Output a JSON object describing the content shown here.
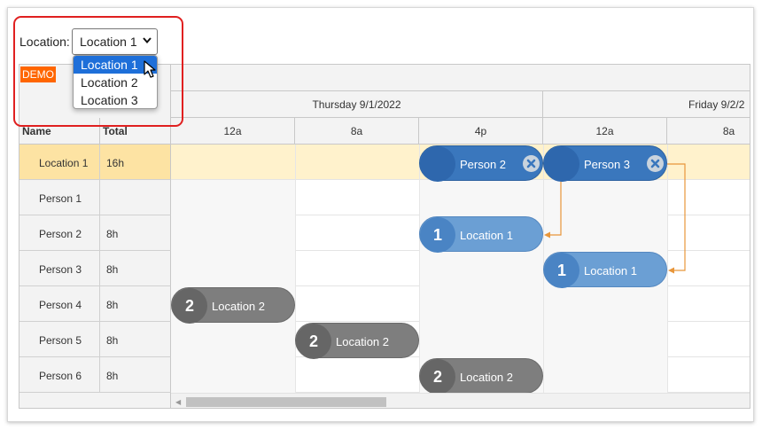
{
  "location_picker": {
    "label": "Location:",
    "selected": "Location 1",
    "options": [
      "Location 1",
      "Location 2",
      "Location 3"
    ]
  },
  "demo_badge": "DEMO",
  "columns": {
    "name": "Name",
    "total": "Total"
  },
  "dates": [
    "Thursday 9/1/2022",
    "Friday 9/2/2"
  ],
  "hours": [
    "12a",
    "8a",
    "4p",
    "12a",
    "8a"
  ],
  "rows": [
    {
      "name": "Location 1",
      "total": "16h"
    },
    {
      "name": "Person 1",
      "total": ""
    },
    {
      "name": "Person 2",
      "total": "8h"
    },
    {
      "name": "Person 3",
      "total": "8h"
    },
    {
      "name": "Person 4",
      "total": "8h"
    },
    {
      "name": "Person 5",
      "total": "8h"
    },
    {
      "name": "Person 6",
      "total": "8h"
    }
  ],
  "events": [
    {
      "label": "Person 2",
      "number": ""
    },
    {
      "label": "Person 3",
      "number": ""
    },
    {
      "label": "Location 1",
      "number": "1"
    },
    {
      "label": "Location 1",
      "number": "1"
    },
    {
      "label": "Location 2",
      "number": "2"
    },
    {
      "label": "Location 2",
      "number": "2"
    },
    {
      "label": "Location 2",
      "number": "2"
    }
  ],
  "colors": {
    "location_row": "#fff2cc",
    "selected_option": "#1e6fd9",
    "highlight": "#e02020",
    "link_line": "#e8963a",
    "demo": "#ff6600"
  }
}
